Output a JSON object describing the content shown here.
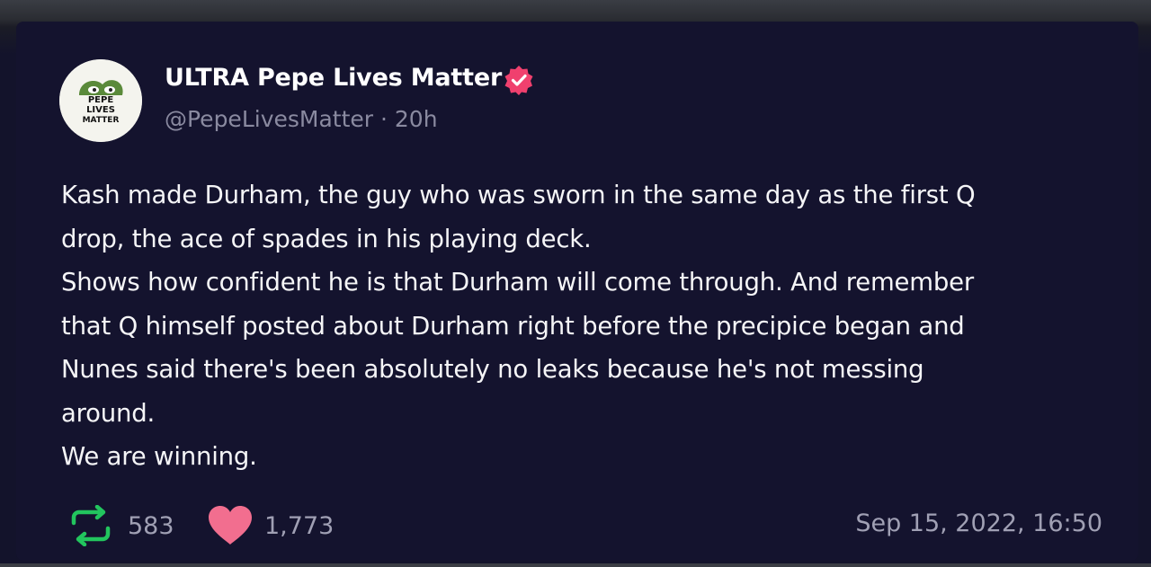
{
  "post": {
    "display_name": "ULTRA Pepe Lives Matter",
    "handle": "@PepeLivesMatter",
    "separator": "·",
    "age": "20h",
    "avatar_text": [
      "PEPE",
      "LIVES",
      "MATTER"
    ],
    "body_lines": [
      "Kash made Durham, the guy who was sworn in the same day as the first Q",
      "drop, the ace of spades in his playing deck.",
      "Shows how confident he is that Durham will come through. And remember",
      "that Q himself posted about Durham right before the precipice began and",
      "Nunes said there's been absolutely no leaks because he's not messing",
      "around.",
      "We are winning."
    ],
    "reposts": "583",
    "likes": "1,773",
    "date": "Sep 15, 2022, 16:50"
  },
  "colors": {
    "background": "#14132e",
    "verified_badge": "#f0406e",
    "repost_icon": "#22c55e",
    "like_icon": "#f26e8f",
    "muted_text": "#a0a0b4"
  },
  "icons": {
    "verified": "verified-badge-icon",
    "repost": "repost-icon",
    "like": "heart-icon"
  }
}
